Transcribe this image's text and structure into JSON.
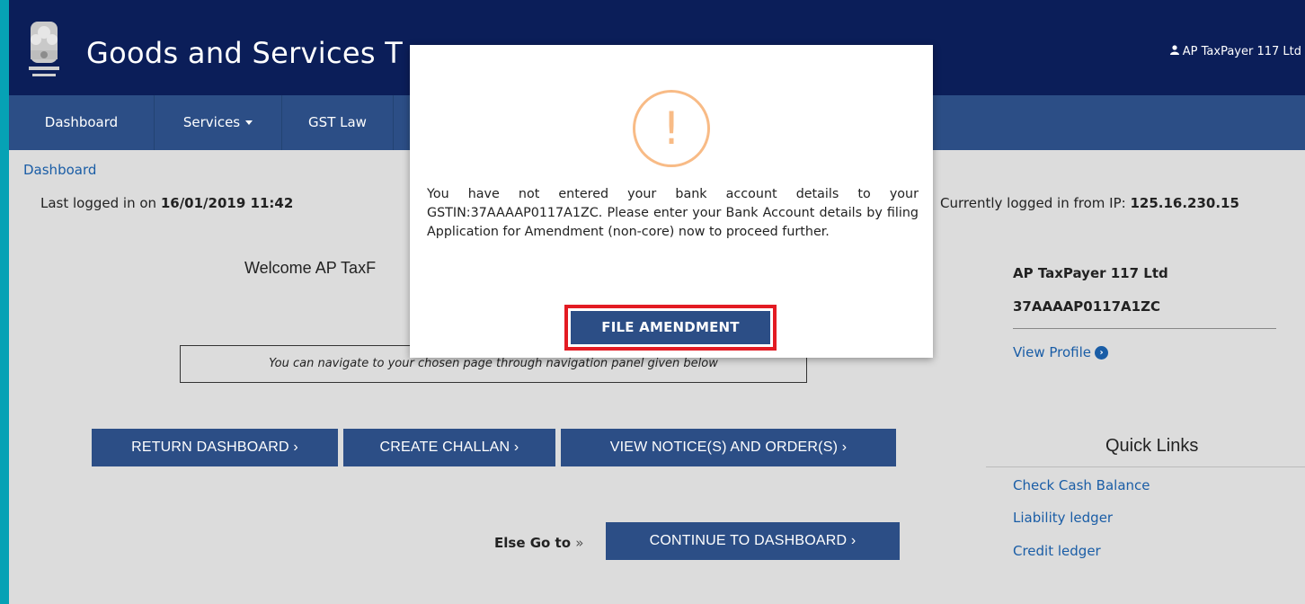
{
  "header": {
    "title": "Goods and Services T",
    "user_name": "AP TaxPayer 117 Ltd"
  },
  "nav": {
    "items": [
      {
        "label": "Dashboard"
      },
      {
        "label": "Services"
      },
      {
        "label": "GST Law"
      }
    ]
  },
  "breadcrumb": "Dashboard",
  "login": {
    "last_prefix": "Last logged in on ",
    "last_value": "16/01/2019 11:42",
    "ip_prefix": "Currently logged in from IP: ",
    "ip_value": "125.16.230.15"
  },
  "welcome": "Welcome AP TaxF",
  "nav_hint": "You can navigate to your chosen page through navigation panel given below",
  "buttons": {
    "return_dashboard": "RETURN DASHBOARD ›",
    "create_challan": "CREATE CHALLAN ›",
    "view_notices": "VIEW NOTICE(S) AND ORDER(S) ›",
    "continue_dashboard": "CONTINUE TO DASHBOARD ›"
  },
  "else_go": {
    "label": "Else Go to",
    "arrow": "»"
  },
  "profile": {
    "name": "AP TaxPayer 117 Ltd",
    "gstin": "37AAAAP0117A1ZC",
    "view_profile": "View Profile"
  },
  "quick_links": {
    "title": "Quick Links",
    "items": [
      {
        "label": "Check Cash Balance"
      },
      {
        "label": "Liability ledger"
      },
      {
        "label": "Credit ledger"
      }
    ]
  },
  "modal": {
    "icon": "warning-icon",
    "message": "You have not entered your bank account details to your GSTIN:37AAAAP0117A1ZC. Please enter your Bank Account details by filing Application for Amendment (non-core) now to proceed further.",
    "button": "FILE AMENDMENT"
  },
  "colors": {
    "header_bg": "#0b1e59",
    "nav_bg": "#2c4e86",
    "accent_border": "#06a2b5",
    "warning": "#f8bb86",
    "highlight": "#e31b23",
    "link": "#1a5da6"
  }
}
